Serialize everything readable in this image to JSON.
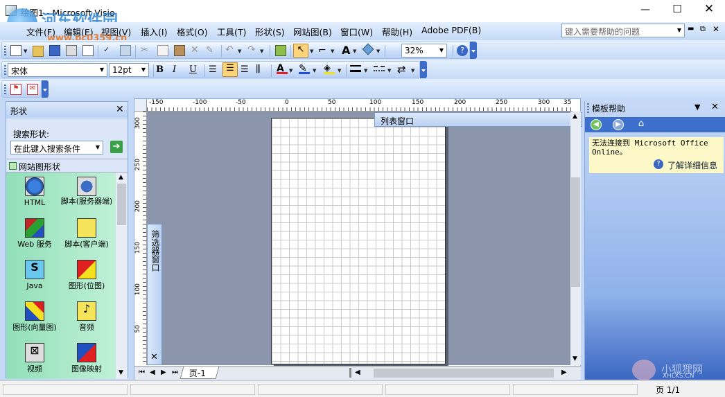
{
  "title": {
    "text": "绘图1 - Microsoft Visio"
  },
  "watermark": {
    "site_name": "河东软件园",
    "site_url": "www.pc0359.cn",
    "corner_brand": "小狐狸网",
    "corner_url": "XHLKS.CN"
  },
  "menu": [
    "文件(F)",
    "编辑(E)",
    "视图(V)",
    "插入(I)",
    "格式(O)",
    "工具(T)",
    "形状(S)",
    "网站图(B)",
    "窗口(W)",
    "帮助(H)",
    "Adobe PDF(B)"
  ],
  "help_search": {
    "placeholder": "键入需要帮助的问题"
  },
  "toolbar": {
    "zoom": "32%",
    "font": "宋体",
    "font_size": "12pt"
  },
  "shapes_pane": {
    "title": "形状",
    "search_label": "搜索形状:",
    "search_placeholder": "在此键入搜索条件",
    "stencil": "网站图形状",
    "items": [
      {
        "label": "HTML",
        "icon": "globe-icon"
      },
      {
        "label": "脚本(服务器端)",
        "icon": "server-script-icon"
      },
      {
        "label": "Web 服务",
        "icon": "web-service-icon"
      },
      {
        "label": "脚本(客户端)",
        "icon": "client-script-icon"
      },
      {
        "label": "Java",
        "icon": "java-icon"
      },
      {
        "label": "图形(位图)",
        "icon": "bitmap-icon"
      },
      {
        "label": "图形(向量图)",
        "icon": "vector-icon"
      },
      {
        "label": "音频",
        "icon": "audio-icon"
      },
      {
        "label": "视频",
        "icon": "video-icon"
      },
      {
        "label": "图像映射",
        "icon": "image-map-icon"
      }
    ]
  },
  "ruler": {
    "labels": [
      "-150",
      "-100",
      "-50",
      "0",
      "50",
      "100",
      "150",
      "200",
      "250",
      "300",
      "35"
    ]
  },
  "vruler": {
    "labels": [
      "300",
      "250",
      "200",
      "150",
      "100",
      "50"
    ]
  },
  "list_window": {
    "title": "列表窗口"
  },
  "filter_window": {
    "title": "筛选器窗口"
  },
  "page_tab": {
    "label": "页-1"
  },
  "help_pane": {
    "title": "模板帮助",
    "message": "无法连接到 Microsoft Office Online。",
    "link": "了解详细信息"
  },
  "status": {
    "page": "页 1/1"
  }
}
